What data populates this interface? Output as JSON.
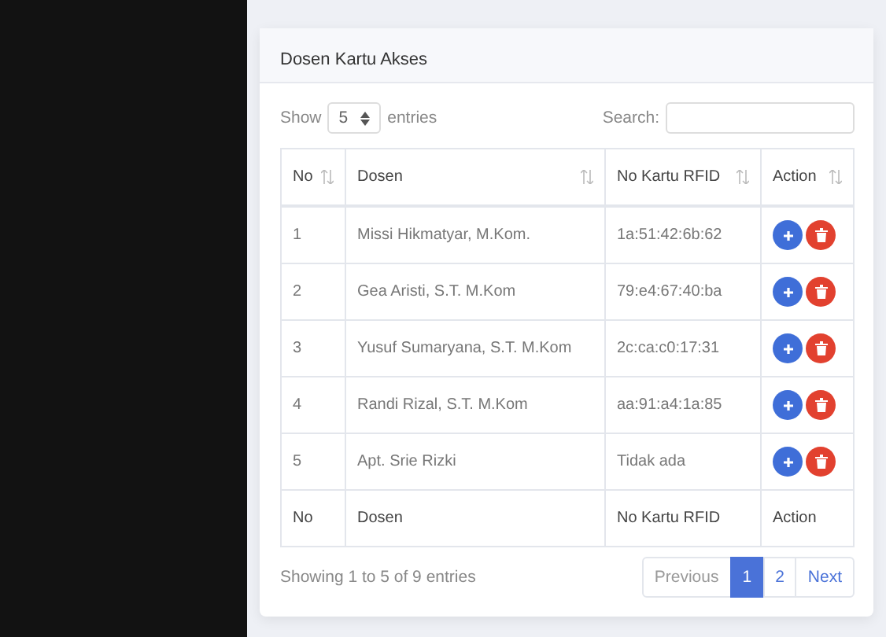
{
  "card": {
    "title": "Dosen Kartu Akses"
  },
  "length_control": {
    "prefix": "Show",
    "value": "5",
    "suffix": "entries"
  },
  "search": {
    "label": "Search:"
  },
  "table": {
    "columns": [
      {
        "label": "No",
        "sortable": true
      },
      {
        "label": "Dosen",
        "sortable": true
      },
      {
        "label": "No Kartu RFID",
        "sortable": true
      },
      {
        "label": "Action",
        "sortable": true
      }
    ],
    "rows": [
      {
        "no": "1",
        "dosen": "Missi Hikmatyar, M.Kom.",
        "rfid": "1a:51:42:6b:62"
      },
      {
        "no": "2",
        "dosen": "Gea Aristi, S.T. M.Kom",
        "rfid": "79:e4:67:40:ba"
      },
      {
        "no": "3",
        "dosen": "Yusuf Sumaryana, S.T. M.Kom",
        "rfid": "2c:ca:c0:17:31"
      },
      {
        "no": "4",
        "dosen": "Randi Rizal, S.T. M.Kom",
        "rfid": "aa:91:a4:1a:85"
      },
      {
        "no": "5",
        "dosen": "Apt. Srie Rizki",
        "rfid": "Tidak ada"
      }
    ],
    "footer": [
      "No",
      "Dosen",
      "No Kartu RFID",
      "Action"
    ]
  },
  "info": "Showing 1 to 5 of 9 entries",
  "pagination": [
    {
      "label": "Previous",
      "kind": "nav",
      "selected": false
    },
    {
      "label": "1",
      "kind": "page",
      "selected": true
    },
    {
      "label": "2",
      "kind": "page",
      "selected": false
    },
    {
      "label": "Next",
      "kind": "nav",
      "selected": false
    }
  ]
}
